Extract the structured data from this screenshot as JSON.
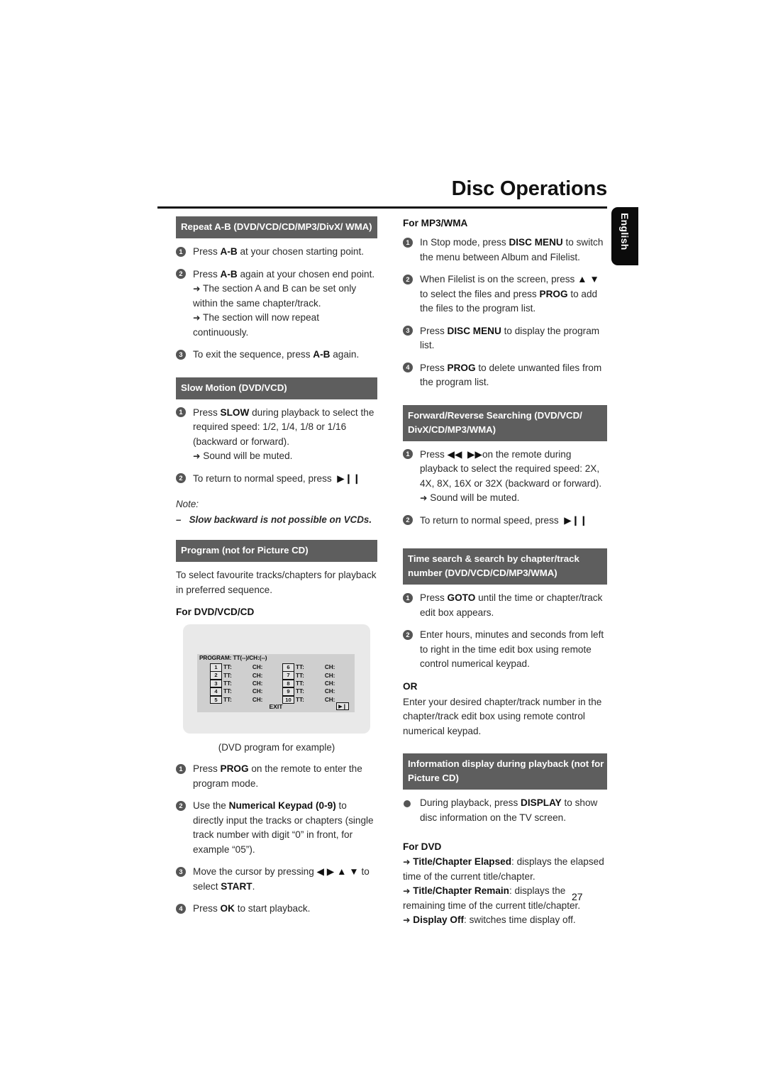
{
  "header": {
    "title": "Disc Operations",
    "language_tab": "English"
  },
  "page_number": "27",
  "left_column": {
    "sections": [
      {
        "bar": "Repeat A-B (DVD/VCD/CD/MP3/DivX/ WMA)",
        "steps": [
          {
            "num": "1",
            "text_html": "Press <b>A-B</b> at your chosen starting point."
          },
          {
            "num": "2",
            "text_html": "Press <b>A-B</b> again at your chosen end point.<span class=\"sub\"><span class=\"arr\">➜</span> The section A and B can be set only within the same chapter/track.</span><span class=\"sub\"><span class=\"arr\">➜</span> The section will now repeat continuously.</span>"
          },
          {
            "num": "3",
            "text_html": "To exit the sequence, press <b>A-B</b> again."
          }
        ]
      },
      {
        "bar": "Slow Motion (DVD/VCD)",
        "steps": [
          {
            "num": "1",
            "text_html": "Press <b>SLOW</b> during playback to select the required speed: 1/2, 1/4, 1/8 or 1/16 (backward or forward).<span class=\"sub\"><span class=\"arr\">➜</span> Sound will be muted.</span>"
          },
          {
            "num": "2",
            "text_html": "To return to normal speed, press &nbsp;<b>▶❙❙</b>"
          }
        ],
        "note_label": "Note:",
        "note_item": "–   Slow backward is not possible on VCDs."
      },
      {
        "bar": "Program (not for Picture CD)",
        "intro": "To select favourite tracks/chapters for playback in preferred sequence.",
        "sub_head": "For DVD/VCD/CD",
        "figure_caption": "(DVD program for example)",
        "steps": [
          {
            "num": "1",
            "text_html": "Press <b>PROG</b> on the remote to enter the program mode."
          },
          {
            "num": "2",
            "text_html": "Use the <b>Numerical Keypad (0-9)</b> to directly input the tracks or chapters (single track number with digit “0” in front, for example “05”)."
          },
          {
            "num": "3",
            "text_html": "Move the cursor by pressing <b>◀ ▶ ▲ ▼</b> to select <b>START</b>."
          },
          {
            "num": "4",
            "text_html": "Press <b>OK</b> to start playback."
          }
        ]
      }
    ]
  },
  "program_figure": {
    "title": "PROGRAM: TT(--)/CH:(--)",
    "rows": [
      {
        "left_index": "1",
        "left_tt": "TT:",
        "left_ch": "CH:",
        "right_index": "6",
        "right_tt": "TT:",
        "right_ch": "CH:"
      },
      {
        "left_index": "2",
        "left_tt": "TT:",
        "left_ch": "CH:",
        "right_index": "7",
        "right_tt": "TT:",
        "right_ch": "CH:"
      },
      {
        "left_index": "3",
        "left_tt": "TT:",
        "left_ch": "CH:",
        "right_index": "8",
        "right_tt": "TT:",
        "right_ch": "CH:"
      },
      {
        "left_index": "4",
        "left_tt": "TT:",
        "left_ch": "CH:",
        "right_index": "9",
        "right_tt": "TT:",
        "right_ch": "CH:"
      },
      {
        "left_index": "5",
        "left_tt": "TT:",
        "left_ch": "CH:",
        "right_index": "10",
        "right_tt": "TT:",
        "right_ch": "CH:"
      }
    ],
    "exit_label": "EXIT",
    "play_icon": "▶❙"
  },
  "right_column": {
    "sections": [
      {
        "sub_head": "For MP3/WMA",
        "steps": [
          {
            "num": "1",
            "text_html": "In Stop mode, press <b>DISC MENU</b> to switch the menu between Album and Filelist."
          },
          {
            "num": "2",
            "text_html": "When Filelist is on the screen, press <b>▲ ▼</b> to select the files and press <b>PROG</b> to add the files to the program list."
          },
          {
            "num": "3",
            "text_html": "Press <b>DISC MENU</b> to display the program list."
          },
          {
            "num": "4",
            "text_html": "Press <b>PROG</b> to delete unwanted files from the program list."
          }
        ]
      },
      {
        "bar": "Forward/Reverse Searching (DVD/VCD/ DivX/CD/MP3/WMA)",
        "steps": [
          {
            "num": "1",
            "text_html": "Press <b>◀◀</b> &nbsp;<b>▶▶</b>on the remote during playback to select the required speed: 2X, 4X, 8X, 16X or 32X (backward or forward).<span class=\"sub\"><span class=\"arr\">➜</span> Sound will be muted.</span>"
          },
          {
            "num": "2",
            "text_html": "To return to normal speed, press &nbsp;<b>▶❙❙</b>"
          }
        ]
      },
      {
        "bar": "Time search & search by chapter/track number (DVD/VCD/CD/MP3/WMA)",
        "steps": [
          {
            "num": "1",
            "text_html": "Press <b>GOTO</b> until the time or chapter/track edit box appears."
          },
          {
            "num": "2",
            "text_html": "Enter hours, minutes and seconds from left to right in the time edit box using remote control numerical keypad."
          }
        ],
        "or_label": "OR",
        "or_text": "Enter your desired chapter/track number in the chapter/track edit box using remote control numerical keypad."
      },
      {
        "bar": "Information display during playback (not for Picture CD)",
        "dot_step": "During playback, press <b>DISPLAY</b> to show disc information on the TV screen.",
        "sub_head": "For DVD",
        "arrow_items": [
          "<span class=\"arr\">➜</span> <b>Title/Chapter Elapsed</b>: displays the elapsed time of the current title/chapter.",
          "<span class=\"arr\">➜</span> <b>Title/Chapter Remain</b>: displays the remaining time of the current title/chapter.",
          "<span class=\"arr\">➜</span> <b>Display Off</b>: switches time display off."
        ]
      }
    ]
  }
}
